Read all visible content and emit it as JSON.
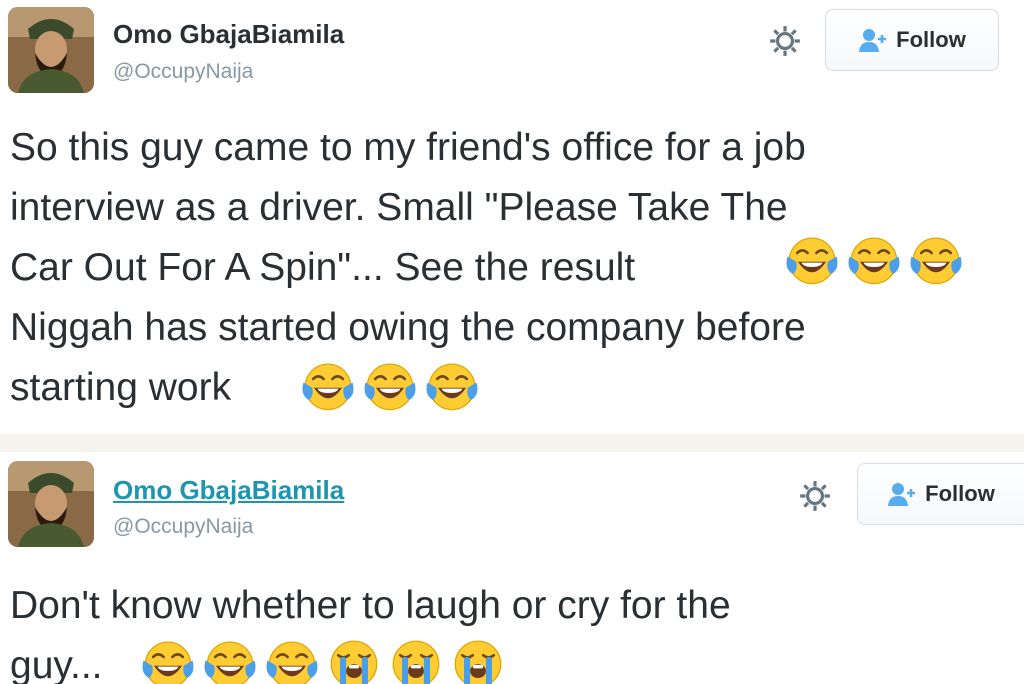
{
  "tweets": [
    {
      "author_name": "Omo GbajaBiamila",
      "author_handle": "@OccupyNaija",
      "follow_label": "Follow",
      "text": "So this guy came to my friend's office for a job\ninterview as a driver. Small \"Please Take The\nCar Out For A Spin\"... See the result\nNiggah has started owing the company before\nstarting work",
      "emoji_groups": [
        [
          "face-with-tears-of-joy-icon",
          "face-with-tears-of-joy-icon",
          "face-with-tears-of-joy-icon"
        ],
        [
          "face-with-tears-of-joy-icon",
          "face-with-tears-of-joy-icon",
          "face-with-tears-of-joy-icon"
        ]
      ]
    },
    {
      "author_name": "Omo GbajaBiamila",
      "author_handle": "@OccupyNaija",
      "follow_label": "Follow",
      "text": "Don't know whether to laugh or cry for the\nguy...",
      "emoji_groups": [
        [
          "face-with-tears-of-joy-icon",
          "face-with-tears-of-joy-icon",
          "face-with-tears-of-joy-icon",
          "loudly-crying-face-icon",
          "loudly-crying-face-icon",
          "loudly-crying-face-icon"
        ]
      ]
    }
  ],
  "colors": {
    "text": "#292f33",
    "handle": "#8899a6",
    "link_name": "#1b95b0",
    "follow_icon": "#55acee",
    "emoji_yellow": "#ffcc33",
    "emoji_tear": "#4a9fe8"
  }
}
